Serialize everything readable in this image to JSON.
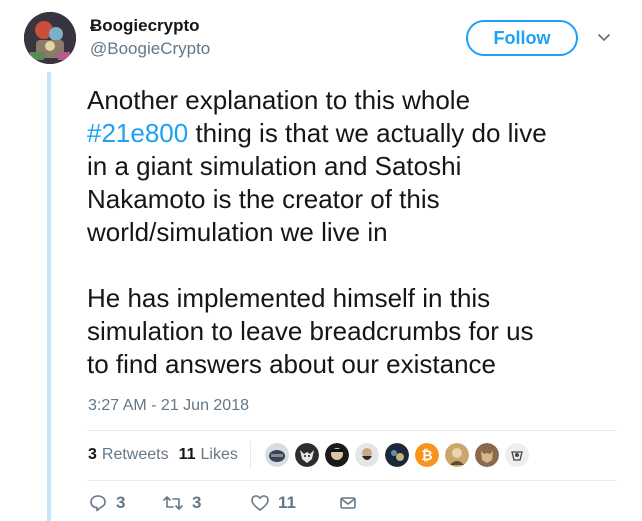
{
  "user": {
    "name": "Ƀoogiecrypto",
    "handle": "@BoogieCrypto"
  },
  "follow_label": "Follow",
  "tweet": {
    "line1": "Another explanation to this whole",
    "hashtag": "#21e800",
    "line2_rest": " thing is that we actually do live",
    "line3": "in a giant simulation and Satoshi",
    "line4": "Nakamoto is the creator of this",
    "line5": "world/simulation we live in",
    "line6": "He has implemented himself in this",
    "line7": "simulation to leave breadcrumbs for us",
    "line8": "to find answers about our existance"
  },
  "timestamp": "3:27 AM - 21 Jun 2018",
  "stats": {
    "retweets_count": "3",
    "retweets_label": "Retweets",
    "likes_count": "11",
    "likes_label": "Likes"
  },
  "actions": {
    "reply_count": "3",
    "retweet_count": "3",
    "like_count": "11"
  },
  "colors": {
    "accent": "#1da1f2",
    "secondary_text": "#657786",
    "thread_line": "#c4e4f7",
    "bitcoin": "#f7931a"
  },
  "liker_avatars": [
    "helmet-avatar",
    "wolf-avatar",
    "face-avatar",
    "bearded-avatar",
    "dark-avatar",
    "bitcoin-avatar",
    "portrait-avatar",
    "cat-avatar",
    "sketch-avatar"
  ]
}
